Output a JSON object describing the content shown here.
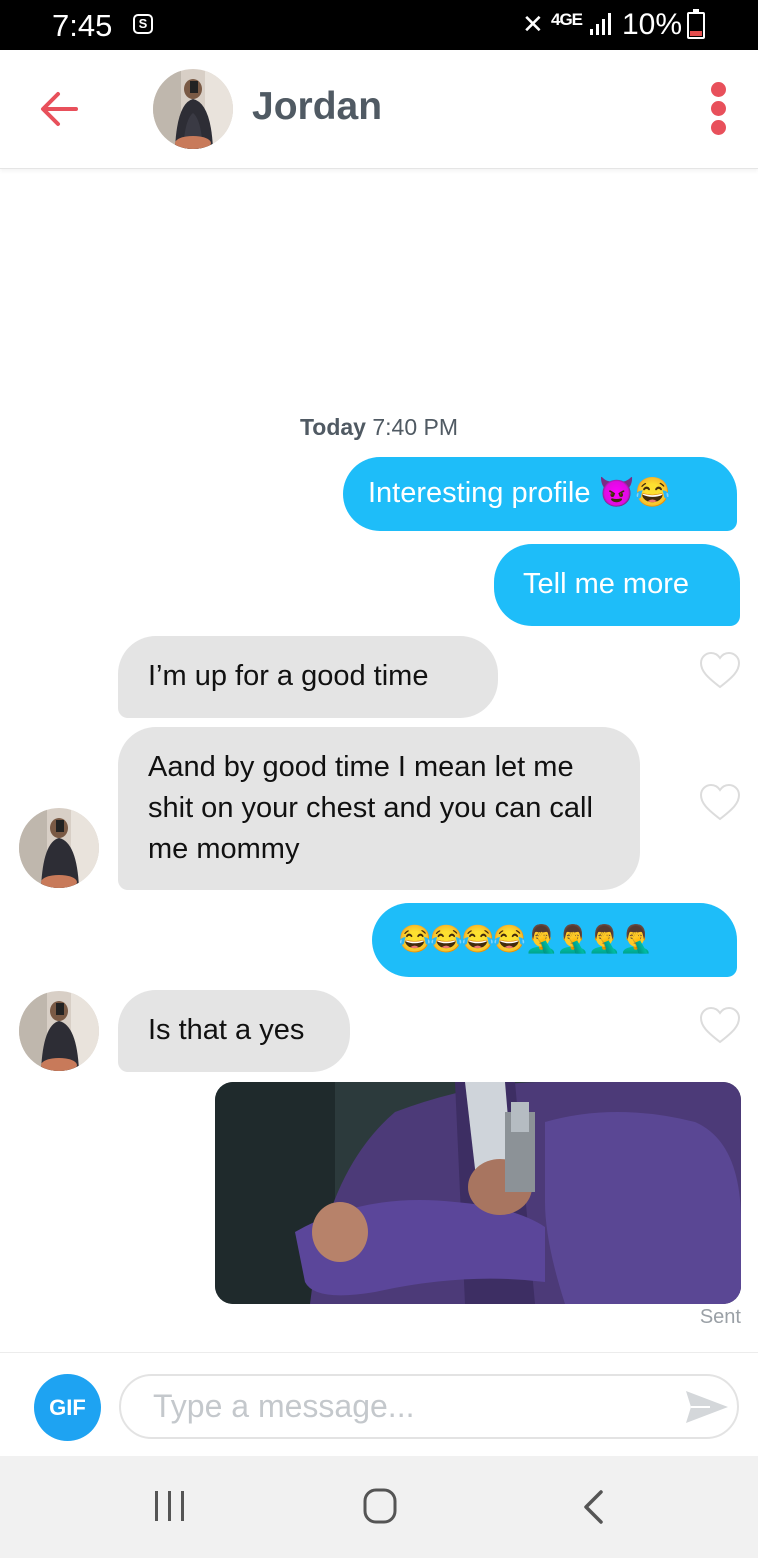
{
  "status_bar": {
    "time": "7:45",
    "sync_icon": "S",
    "network": "4GE",
    "battery_percent": "10%"
  },
  "header": {
    "contact_name": "Jordan",
    "back_icon": "arrow-left-icon",
    "menu_icon": "more-vertical-icon",
    "accent_color": "#e8505b"
  },
  "conversation": {
    "date_label_day": "Today",
    "date_label_time": "7:40 PM",
    "messages": [
      {
        "direction": "outgoing",
        "text": "Interesting profile 😈😂"
      },
      {
        "direction": "outgoing",
        "text": "Tell me more"
      },
      {
        "direction": "incoming",
        "text": "I’m up for a good time"
      },
      {
        "direction": "incoming",
        "text": "Aand by good time I mean let me shit on your chest and you can call me mommy"
      },
      {
        "direction": "outgoing",
        "text": "😂😂😂😂🤦‍♂️🤦‍♂️🤦‍♂️🤦‍♂️"
      },
      {
        "direction": "incoming",
        "text": "Is that a yes"
      },
      {
        "direction": "outgoing",
        "type": "gif"
      }
    ],
    "sent_label": "Sent",
    "outgoing_color": "#1ebdf9",
    "incoming_color": "#e4e4e4"
  },
  "composer": {
    "gif_label": "GIF",
    "placeholder": "Type a message..."
  }
}
